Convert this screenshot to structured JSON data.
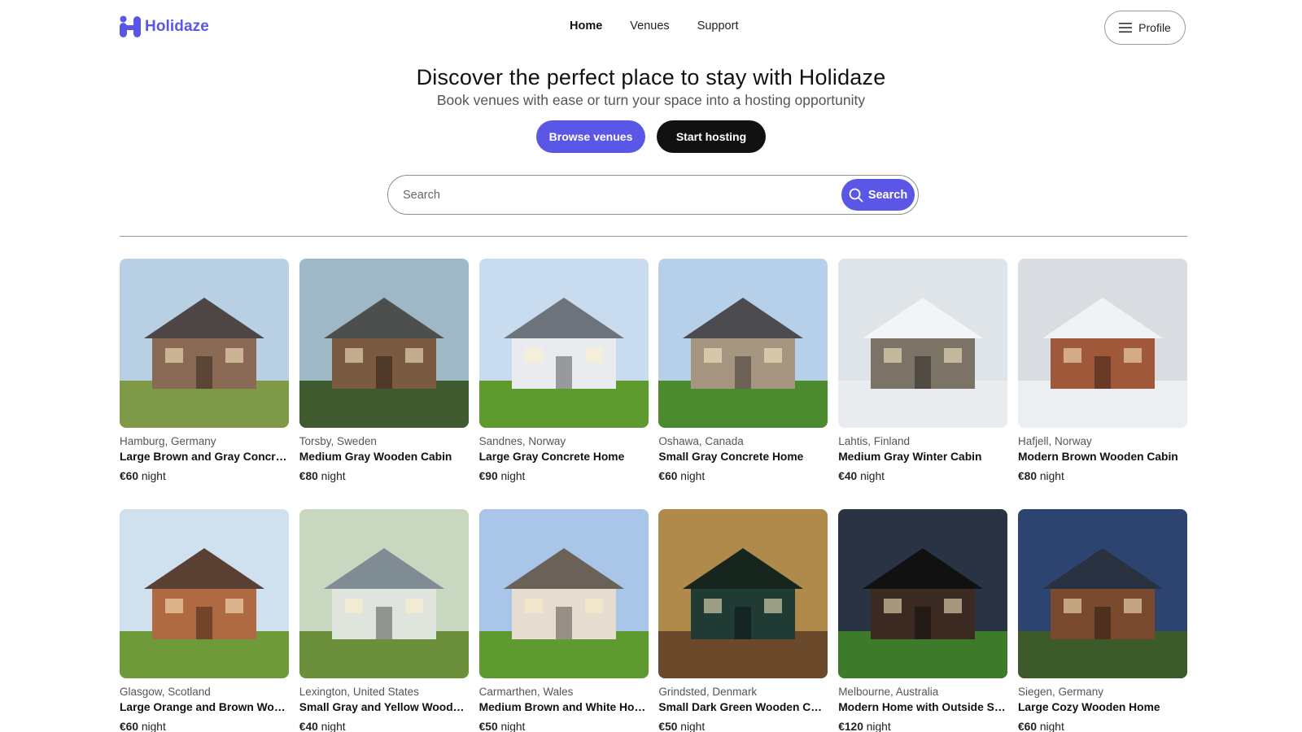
{
  "brand": {
    "name": "Holidaze",
    "color": "#5b57e6"
  },
  "nav": {
    "items": [
      "Home",
      "Venues",
      "Support"
    ],
    "active": "Home"
  },
  "profile": {
    "label": "Profile",
    "icon": "menu-icon"
  },
  "hero": {
    "title": "Discover the perfect place to stay with Holidaze",
    "subtitle": "Book venues with ease or turn your space into a hosting opportunity",
    "browse_label": "Browse venues",
    "host_label": "Start hosting"
  },
  "search": {
    "placeholder": "Search",
    "button_label": "Search",
    "icon": "search-icon"
  },
  "price_unit": "night",
  "venues": [
    {
      "location": "Hamburg, Germany",
      "title": "Large Brown and Gray Concrete Home",
      "price": "€60",
      "sky": "#b9cfe3",
      "body": "#8a6a55",
      "roof": "#4e4644",
      "ground": "#7e9a48"
    },
    {
      "location": "Torsby, Sweden",
      "title": "Medium Gray Wooden Cabin",
      "price": "€80",
      "sky": "#9fb8c8",
      "body": "#7a5a40",
      "roof": "#4d4f4f",
      "ground": "#3f5a2e"
    },
    {
      "location": "Sandnes, Norway",
      "title": "Large Gray Concrete Home",
      "price": "€90",
      "sky": "#c9dbee",
      "body": "#e9ecef",
      "roof": "#6c737a",
      "ground": "#5f9a2f"
    },
    {
      "location": "Oshawa, Canada",
      "title": "Small Gray Concrete Home",
      "price": "€60",
      "sky": "#b7d0ea",
      "body": "#a69581",
      "roof": "#4c4c50",
      "ground": "#4b8a2f"
    },
    {
      "location": "Lahtis, Finland",
      "title": "Medium Gray Winter Cabin",
      "price": "€40",
      "sky": "#dfe4e8",
      "body": "#7b7466",
      "roof": "#f3f4f5",
      "ground": "#e8ecef"
    },
    {
      "location": "Hafjell, Norway",
      "title": "Modern Brown Wooden Cabin",
      "price": "€80",
      "sky": "#d9dde2",
      "body": "#a0583b",
      "roof": "#f1f2f3",
      "ground": "#eceff1"
    },
    {
      "location": "Glasgow, Scotland",
      "title": "Large Orange and Brown Wooden Home",
      "price": "€60",
      "sky": "#cfe0ee",
      "body": "#b06a42",
      "roof": "#5a3f33",
      "ground": "#6f9a3a"
    },
    {
      "location": "Lexington, United States",
      "title": "Small Gray and Yellow Wooden Home",
      "price": "€40",
      "sky": "#c8d8c0",
      "body": "#dfe4dc",
      "roof": "#7f8c94",
      "ground": "#6b8f3a"
    },
    {
      "location": "Carmarthen, Wales",
      "title": "Medium Brown and White Home",
      "price": "€50",
      "sky": "#a9c5e8",
      "body": "#e6ddd0",
      "roof": "#6a6258",
      "ground": "#5f9a30"
    },
    {
      "location": "Grindsted, Denmark",
      "title": "Small Dark Green Wooden Cabin",
      "price": "€50",
      "sky": "#b08a4a",
      "body": "#1f3b33",
      "roof": "#17251f",
      "ground": "#6a4a2a"
    },
    {
      "location": "Melbourne, Australia",
      "title": "Modern Home with Outside Space",
      "price": "€120",
      "sky": "#2a3344",
      "body": "#3a2a22",
      "roof": "#111111",
      "ground": "#3d7a2a"
    },
    {
      "location": "Siegen, Germany",
      "title": "Large Cozy Wooden Home",
      "price": "€60",
      "sky": "#2d4470",
      "body": "#7a4a2e",
      "roof": "#2a3140",
      "ground": "#3c5a2a"
    }
  ]
}
